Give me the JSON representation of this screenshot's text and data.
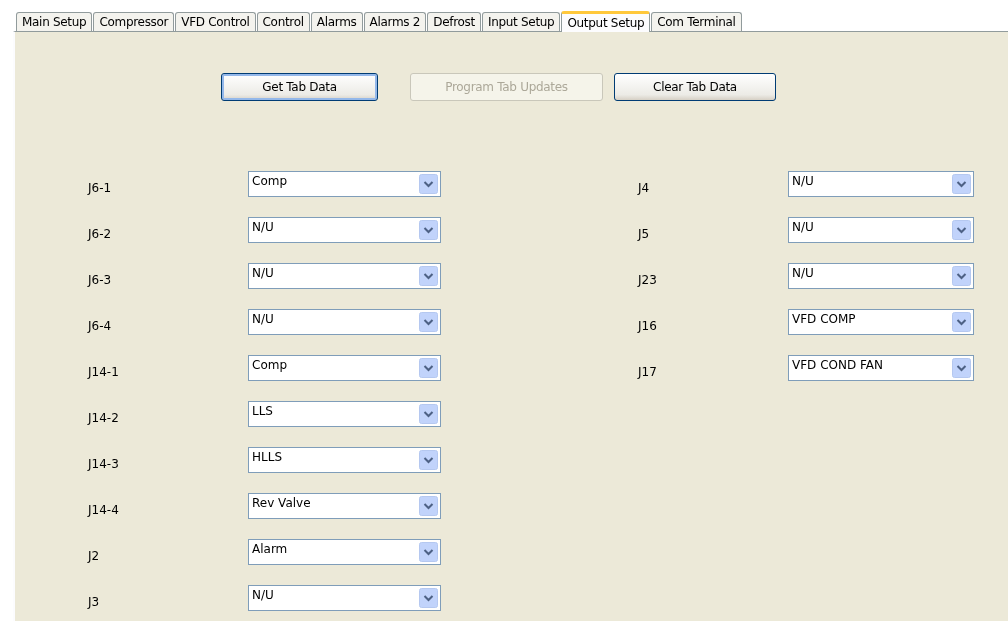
{
  "tabs": [
    {
      "label": "Main Setup",
      "selected": false
    },
    {
      "label": "Compressor",
      "selected": false
    },
    {
      "label": "VFD Control",
      "selected": false
    },
    {
      "label": "Control",
      "selected": false
    },
    {
      "label": "Alarms",
      "selected": false
    },
    {
      "label": "Alarms 2",
      "selected": false
    },
    {
      "label": "Defrost",
      "selected": false
    },
    {
      "label": "Input Setup",
      "selected": false
    },
    {
      "label": "Output Setup",
      "selected": true
    },
    {
      "label": "Com Terminal",
      "selected": false
    }
  ],
  "buttons": [
    {
      "label": "Get Tab Data",
      "disabled": false,
      "focused": true
    },
    {
      "label": "Program Tab Updates",
      "disabled": true,
      "focused": false
    },
    {
      "label": "Clear Tab Data",
      "disabled": false,
      "focused": false
    }
  ],
  "left_outputs": [
    {
      "label": "J6-1",
      "value": "Comp"
    },
    {
      "label": "J6-2",
      "value": "N/U"
    },
    {
      "label": "J6-3",
      "value": "N/U"
    },
    {
      "label": "J6-4",
      "value": "N/U"
    },
    {
      "label": "J14-1",
      "value": "Comp"
    },
    {
      "label": "J14-2",
      "value": "LLS"
    },
    {
      "label": "J14-3",
      "value": "HLLS"
    },
    {
      "label": "J14-4",
      "value": "Rev Valve"
    },
    {
      "label": "J2",
      "value": "Alarm"
    },
    {
      "label": "J3",
      "value": "N/U"
    }
  ],
  "right_outputs": [
    {
      "label": "J4",
      "value": "N/U"
    },
    {
      "label": "J5",
      "value": "N/U"
    },
    {
      "label": "J23",
      "value": "N/U"
    },
    {
      "label": "J16",
      "value": "VFD COMP"
    },
    {
      "label": "J17",
      "value": "VFD COND FAN"
    }
  ]
}
